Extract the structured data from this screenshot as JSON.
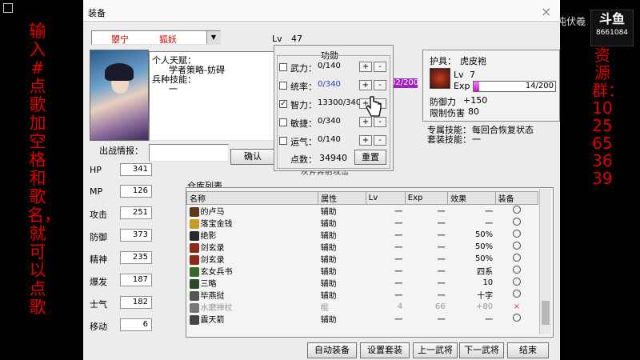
{
  "left_banner": "输入#点歌加空格和歌名，就可以点歌",
  "right_banner": "资源群：1025653639",
  "top_right_label": "混沌伏羲",
  "logo": {
    "text": "斗鱼",
    "id": "8661084"
  },
  "window": {
    "title": "装备",
    "close": "×",
    "name_dropdown": {
      "left": "曌宁",
      "right": "狐妖",
      "arrow": "▼"
    },
    "lv_label": "Lv",
    "lv_value": "47",
    "talent_title": "个人天赋：",
    "talent_text": "学者策略-妨碍",
    "skill_title": "兵种技能：",
    "skill_text": "一",
    "battle_info_label": "出战情报：",
    "confirm_button": "确认",
    "stats": [
      {
        "label": "HP",
        "value": "341"
      },
      {
        "label": "MP",
        "value": "126"
      },
      {
        "label": "攻击",
        "value": "251"
      },
      {
        "label": "防御",
        "value": "373"
      },
      {
        "label": "精神",
        "value": "235"
      },
      {
        "label": "爆发",
        "value": "187"
      },
      {
        "label": "士气",
        "value": "182"
      },
      {
        "label": "移动",
        "value": "6"
      }
    ]
  },
  "kungfu": {
    "title": "功勋",
    "rows": [
      {
        "label": "武力：",
        "value": "0/140",
        "checked": false
      },
      {
        "label": "统率：",
        "value": "0/340",
        "checked": false
      },
      {
        "label": "智力：",
        "value": "13300/340",
        "checked": true
      },
      {
        "label": "敏捷：",
        "value": "0/340",
        "checked": false
      },
      {
        "label": "运气：",
        "value": "0/140",
        "checked": false
      }
    ],
    "plus": "+",
    "minus": "-",
    "points_label": "点数：",
    "points_value": "34940",
    "reset_button": "重置"
  },
  "behind_text": {
    "exp": "02/200",
    "under": "灰斧奔射攻击"
  },
  "armor": {
    "title_label": "护具：",
    "name": "虎皮袍",
    "lv_label": "Lv",
    "lv_value": "7",
    "exp_label": "Exp",
    "exp_text": "14/200",
    "exp_fraction": 0.07,
    "def_label": "防御力",
    "def_value": "+150",
    "dmg_label": "限制伤害",
    "dmg_value": "80",
    "skill_label": "专属技能：",
    "skill_value": "每回合恢复状态",
    "set_label": "套装技能：",
    "set_value": "一"
  },
  "inventory": {
    "title": "仓库列表",
    "headers": [
      "名称",
      "属性",
      "Lv",
      "Exp",
      "效果",
      "装备"
    ],
    "items": [
      {
        "name": "的卢马",
        "attr": "辅助",
        "lv": "一",
        "exp": "一",
        "effect": "一",
        "eq": "o",
        "icon": "horse-icon",
        "color": "#5a3a1a",
        "dim": false
      },
      {
        "name": "落宝金钱",
        "attr": "辅助",
        "lv": "一",
        "exp": "一",
        "effect": "一",
        "eq": "o",
        "icon": "coin-icon",
        "color": "#c89a2a",
        "dim": false
      },
      {
        "name": "绝影",
        "attr": "辅助",
        "lv": "一",
        "exp": "一",
        "effect": "50%",
        "eq": "o",
        "icon": "horse-icon",
        "color": "#2a2a2a",
        "dim": false
      },
      {
        "name": "剑玄录",
        "attr": "辅助",
        "lv": "一",
        "exp": "一",
        "effect": "50%",
        "eq": "o",
        "icon": "book-icon",
        "color": "#8a2a1a",
        "dim": false
      },
      {
        "name": "剑玄录",
        "attr": "辅助",
        "lv": "一",
        "exp": "一",
        "effect": "50%",
        "eq": "o",
        "icon": "book-icon",
        "color": "#8a2a1a",
        "dim": false
      },
      {
        "name": "玄女兵书",
        "attr": "辅助",
        "lv": "一",
        "exp": "一",
        "effect": "四系",
        "eq": "o",
        "icon": "book-icon",
        "color": "#3a6a2a",
        "dim": false
      },
      {
        "name": "三略",
        "attr": "辅助",
        "lv": "一",
        "exp": "一",
        "effect": "10",
        "eq": "o",
        "icon": "scroll-icon",
        "color": "#2a4a2a",
        "dim": false
      },
      {
        "name": "毕燕挝",
        "attr": "辅助",
        "lv": "一",
        "exp": "一",
        "effect": "十字",
        "eq": "o",
        "icon": "weapon-icon",
        "color": "#555555",
        "dim": false
      },
      {
        "name": "水磨禅杖",
        "attr": "棍",
        "lv": "4",
        "exp": "66",
        "effect": "+80",
        "eq": "×",
        "icon": "staff-icon",
        "color": "#777777",
        "dim": true
      },
      {
        "name": "震天箭",
        "attr": "辅助",
        "lv": "一",
        "exp": "一",
        "effect": "一",
        "eq": "o",
        "icon": "arrow-icon",
        "color": "#444444",
        "dim": false
      }
    ]
  },
  "buttons": [
    "自动装备",
    "设置套装",
    "上一武将",
    "下一武将",
    "结束"
  ]
}
